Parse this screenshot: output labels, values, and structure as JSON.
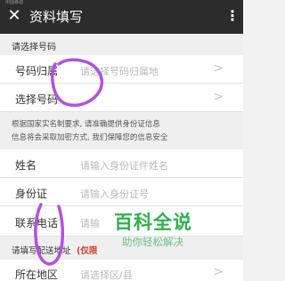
{
  "status": {
    "carrier": "中国移动"
  },
  "header": {
    "close_icon": "close-icon",
    "title": "资料填写",
    "more_icon": "more-vertical-icon",
    "bg_color": "#2c2c2c"
  },
  "section_number": {
    "title": "请选择号码"
  },
  "number_rows": [
    {
      "label": "号码归属",
      "placeholder": "请选择号码归属地",
      "chevron": ">"
    },
    {
      "label": "选择号码",
      "placeholder": "",
      "chevron": ">"
    }
  ],
  "notice": {
    "line1": "根据国家实名制要求, 请准确提供身份证信息",
    "line2": "信息将会采取加密方式, 我们保障您的信息安全"
  },
  "identity_rows": [
    {
      "label": "姓名",
      "placeholder": "请输入身份证件姓名"
    },
    {
      "label": "身份证",
      "placeholder": "请输入身份证号"
    },
    {
      "label": "联系电话",
      "placeholder": "请输"
    }
  ],
  "section_address": {
    "title": "请填写配送地址",
    "remark": "(仅限"
  },
  "address_rows": [
    {
      "label": "所在地区",
      "placeholder": "请选择区/县",
      "chevron": ">"
    }
  ],
  "watermark": {
    "title": "百科全说",
    "subtitle": "助你轻松解决",
    "color": "#2db14b"
  },
  "annotation_color": "#b44fe0"
}
